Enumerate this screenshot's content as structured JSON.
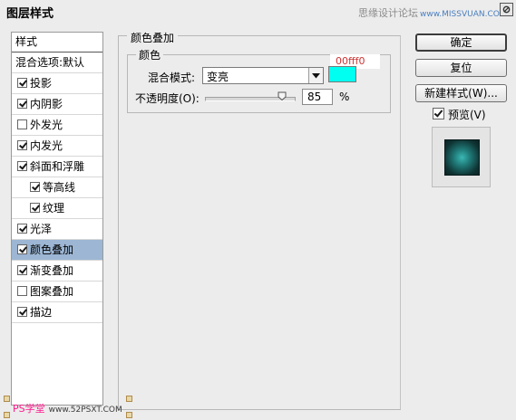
{
  "window": {
    "title": "图层样式",
    "watermark_top": "思缘设计论坛",
    "watermark_top_site": "www.MISSVUAN.COM"
  },
  "sidebar": {
    "header": "样式",
    "blend_options": "混合选项:默认",
    "items": [
      {
        "label": "投影",
        "checked": true
      },
      {
        "label": "内阴影",
        "checked": true
      },
      {
        "label": "外发光",
        "checked": false
      },
      {
        "label": "内发光",
        "checked": true
      },
      {
        "label": "斜面和浮雕",
        "checked": true
      },
      {
        "label": "等高线",
        "checked": true
      },
      {
        "label": "纹理",
        "checked": true
      },
      {
        "label": "光泽",
        "checked": true
      },
      {
        "label": "颜色叠加",
        "checked": true
      },
      {
        "label": "渐变叠加",
        "checked": true
      },
      {
        "label": "图案叠加",
        "checked": false
      },
      {
        "label": "描边",
        "checked": true
      }
    ]
  },
  "panel": {
    "section_title": "颜色叠加",
    "group_title": "颜色",
    "blend_mode_label": "混合模式:",
    "blend_mode_value": "变亮",
    "color_hex": "00fff0",
    "color_value": "#00fff0",
    "opacity_label": "不透明度(O):",
    "opacity_value": "85",
    "opacity_percent": 85,
    "opacity_unit": "%"
  },
  "buttons": {
    "ok": "确定",
    "reset": "复位",
    "new_style": "新建样式(W)...",
    "preview_label": "预览(V)"
  },
  "watermark_bottom": {
    "text": "PS学堂",
    "site": "www.52PSXT.COM"
  }
}
